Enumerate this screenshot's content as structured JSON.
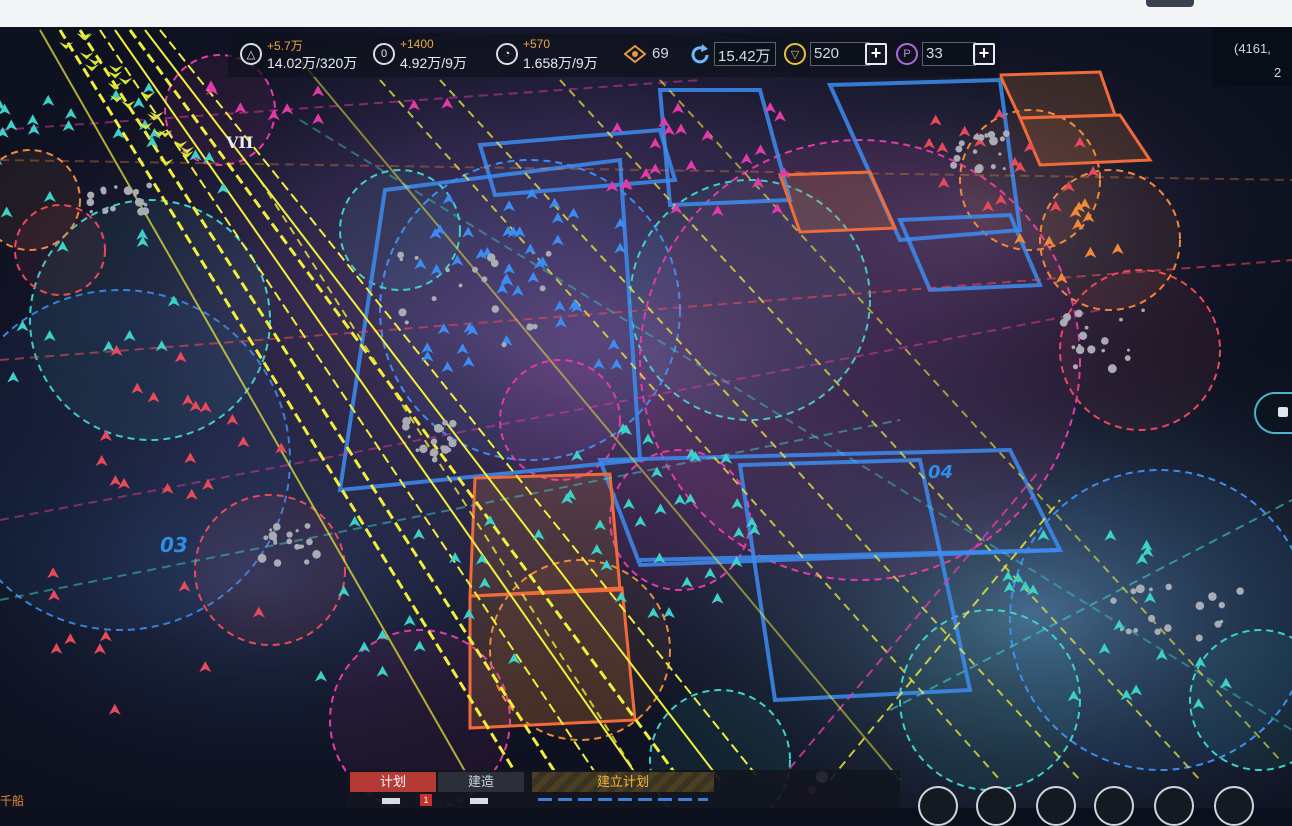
{
  "top_bar": {
    "resources": [
      {
        "icon": "triangle-resource-icon",
        "glyph": "△",
        "delta": "+5.7万",
        "value": "14.02万/320万"
      },
      {
        "icon": "crystal-resource-icon",
        "glyph": "0",
        "delta": "+1400",
        "value": "4.92万/9万"
      },
      {
        "icon": "gas-resource-icon",
        "glyph": "◔",
        "delta": "+570",
        "value": "1.658万/9万"
      }
    ],
    "fleet_count": {
      "icon": "fleet-icon",
      "value": "69"
    },
    "refresh_value": {
      "icon": "refresh-icon",
      "value": "15.42万"
    },
    "gold": {
      "icon": "gold-coin-icon",
      "value": "520"
    },
    "premium": {
      "icon": "premium-token-icon",
      "value": "33"
    }
  },
  "corner_info": {
    "coords": "(4161,",
    "value": "2"
  },
  "map": {
    "sector_labels": [
      "VII",
      "03",
      "04"
    ],
    "colors": {
      "ally": "#3d8cf0",
      "neutral": "#3ed1c8",
      "enemy": "#e84a5a",
      "hostile_magenta": "#e23ba8",
      "caution": "#f08a3a",
      "route": "#f2ef3a"
    }
  },
  "bottom_bar": {
    "tab_plan": "计划",
    "tab_build": "建造",
    "create_plan": "建立计划",
    "plan_badge": "1"
  },
  "bottom_left_text": "千船"
}
